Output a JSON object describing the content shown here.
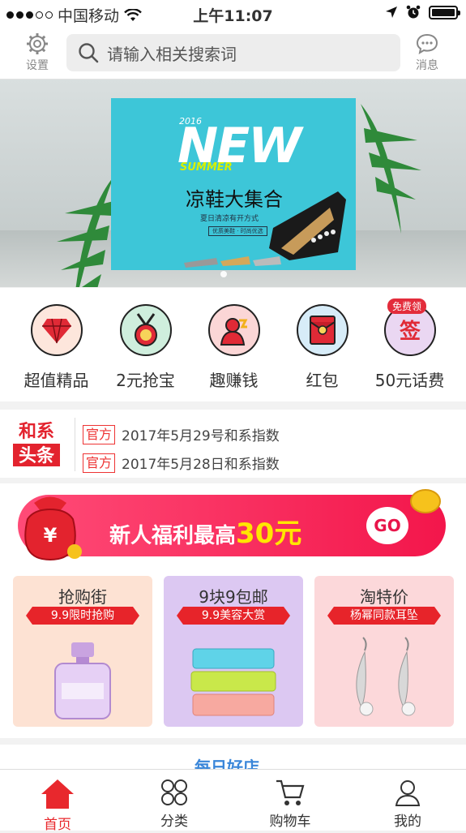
{
  "status_bar": {
    "carrier": "中国移动",
    "time": "上午11:07"
  },
  "header": {
    "settings_label": "设置",
    "search_placeholder": "请输入相关搜索词",
    "messages_label": "消息"
  },
  "banner": {
    "year": "2016",
    "headline": "NEW",
    "season": "SUMMER",
    "title": "凉鞋大集合",
    "subtitle": "夏日清凉有开方式",
    "tagline": "优质美鞋 · 时尚优选",
    "active_slide": 1
  },
  "quick_menu": [
    {
      "label": "超值精品",
      "icon": "diamond-icon"
    },
    {
      "label": "2元抢宝",
      "icon": "medal-icon"
    },
    {
      "label": "趣赚钱",
      "icon": "earn-icon"
    },
    {
      "label": "红包",
      "icon": "red-envelope-icon"
    },
    {
      "label": "50元话费",
      "icon": "sign-icon",
      "badge": "免费领"
    }
  ],
  "headlines": {
    "logo_top": "和系",
    "logo_bottom": "头条",
    "items": [
      {
        "tag": "官方",
        "text": "2017年5月29号和系指数"
      },
      {
        "tag": "官方",
        "text": "2017年5月28日和系指数"
      }
    ]
  },
  "promo": {
    "text": "新人福利最高",
    "amount": "30元",
    "button": "GO"
  },
  "cards": [
    {
      "title": "抢购街",
      "badge": "9.9限时抢购",
      "bg": "#fde2d3"
    },
    {
      "title": "9块9包邮",
      "badge": "9.9美容大赏",
      "bg": "#dcc8f2"
    },
    {
      "title": "淘特价",
      "badge": "杨幂同款耳坠",
      "bg": "#fcd8da"
    }
  ],
  "daily": {
    "title": "每日好店"
  },
  "tabs": [
    {
      "label": "首页",
      "active": true
    },
    {
      "label": "分类",
      "active": false
    },
    {
      "label": "购物车",
      "active": false
    },
    {
      "label": "我的",
      "active": false
    }
  ],
  "colors": {
    "accent": "#e8282d",
    "promo": "#f3164b"
  }
}
